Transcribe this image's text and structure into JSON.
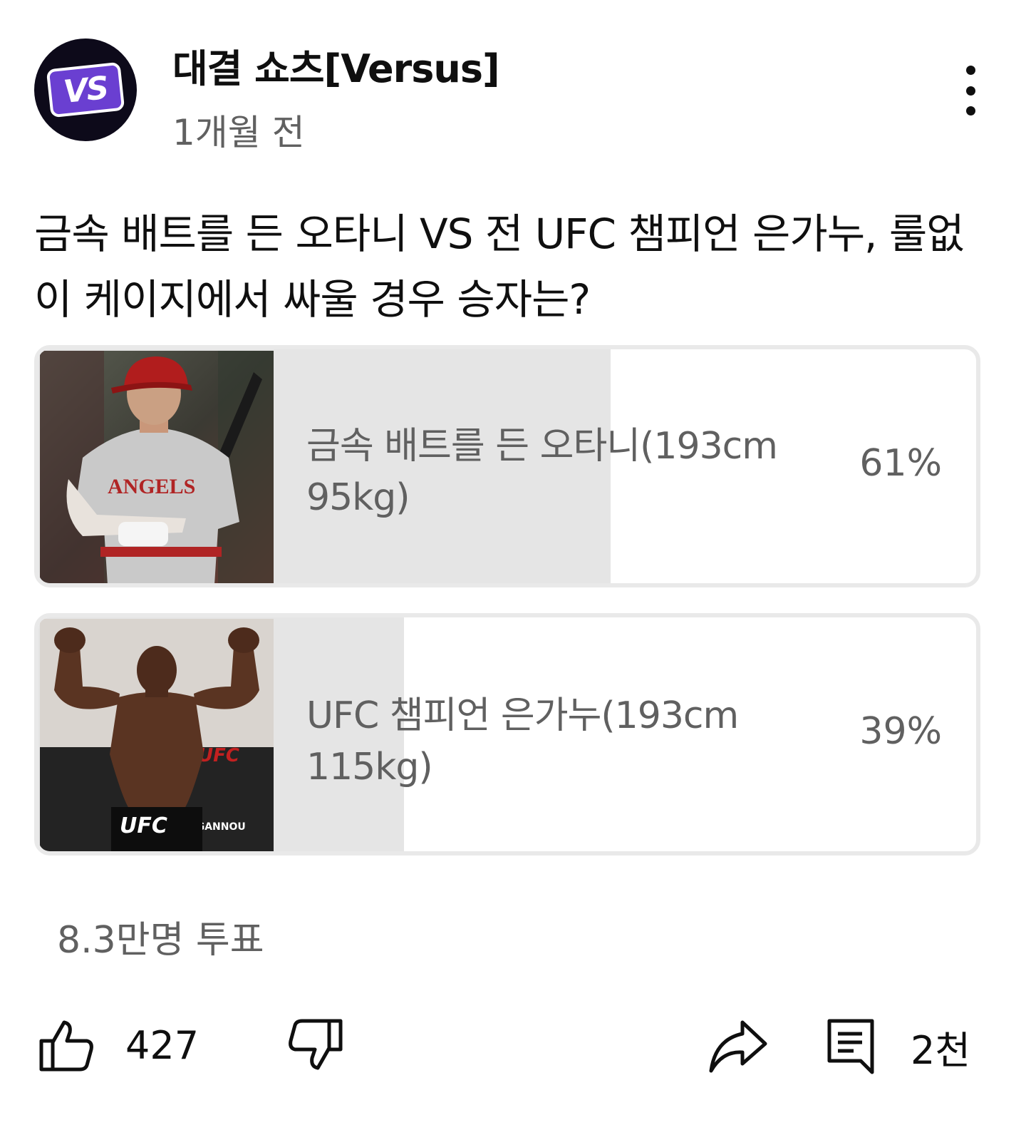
{
  "channel": {
    "name": "대결 쇼츠[Versus]",
    "time": "1개월 전",
    "avatar_text": "VS"
  },
  "post": {
    "question": "금속 배트를 든 오타니 VS 전 UFC 챔피언 은가누, 룰없이 케이지에서 싸울 경우 승자는?"
  },
  "poll": {
    "options": [
      {
        "label": "금속 배트를 든 오타니(193cm 95kg)",
        "percent_text": "61%",
        "percent": 61
      },
      {
        "label": "UFC 챔피언 은가누(193cm 115kg)",
        "percent_text": "39%",
        "percent": 39
      }
    ],
    "total_votes": "8.3만명 투표"
  },
  "actions": {
    "likes": "427",
    "comments": "2천"
  },
  "icons": [
    "more-vert-icon",
    "thumbs-up-icon",
    "thumbs-down-icon",
    "share-icon",
    "comment-icon"
  ]
}
